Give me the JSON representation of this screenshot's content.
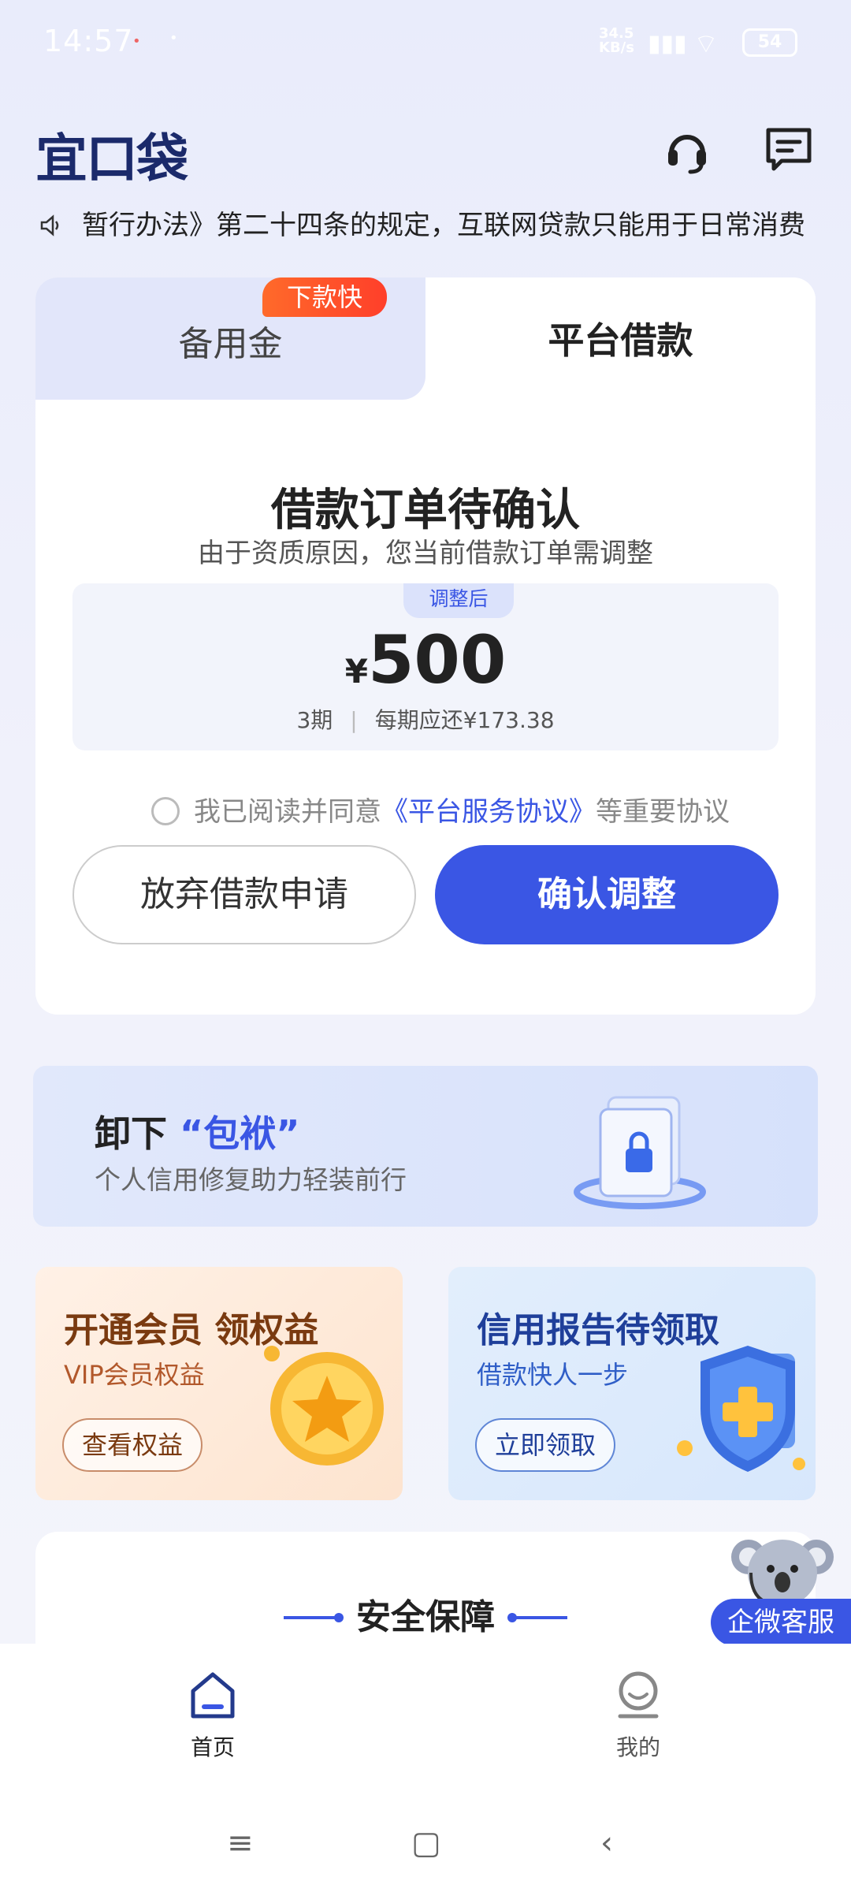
{
  "status_bar": {
    "time": "14:57",
    "net_speed": "34.5 KB/s",
    "network": "HD",
    "battery": "54"
  },
  "header": {
    "logo": "宜口袋",
    "icons": [
      "headset-icon",
      "message-icon"
    ]
  },
  "notice": {
    "text": "暂行办法》第二十四条的规定，互联网贷款只能用于日常消费"
  },
  "tabs": [
    {
      "label": "备用金",
      "badge": "下款快",
      "active": false
    },
    {
      "label": "平台借款",
      "active": true
    }
  ],
  "order": {
    "title": "借款订单待确认",
    "subtitle": "由于资质原因，您当前借款订单需调整",
    "adjusted_tag": "调整后",
    "currency": "¥",
    "amount": "500",
    "periods": "3期",
    "per_period": "每期应还¥173.38"
  },
  "agreement": {
    "prefix": "我已阅读并同意",
    "link": "《平台服务协议》",
    "suffix": "等重要协议",
    "checked": false
  },
  "buttons": {
    "abandon": "放弃借款申请",
    "confirm": "确认调整"
  },
  "banner": {
    "title_prefix": "卸下",
    "title_quote": "“包袱”",
    "subtitle": "个人信用修复助力轻装前行"
  },
  "promo_left": {
    "title": "开通会员 领权益",
    "subtitle": "VIP会员权益",
    "button": "查看权益"
  },
  "promo_right": {
    "title": "信用报告待领取",
    "subtitle": "借款快人一步",
    "button": "立即领取"
  },
  "security": {
    "title": "安全保障"
  },
  "floating": {
    "service": "企微客服"
  },
  "bottom_nav": [
    {
      "label": "首页",
      "icon": "home-icon",
      "active": true
    },
    {
      "label": "我的",
      "icon": "profile-icon",
      "active": false
    }
  ],
  "colors": {
    "accent": "#3a56e4",
    "badge": "#ff4a2a",
    "brand_dark": "#1b2a6b"
  }
}
